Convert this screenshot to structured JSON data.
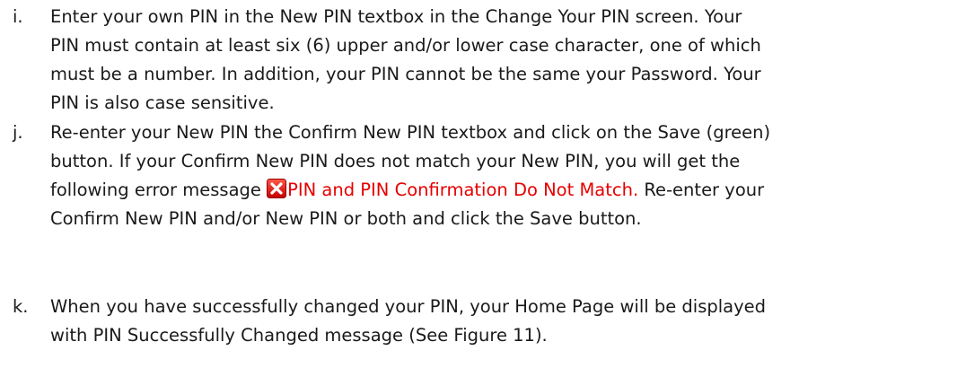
{
  "items": [
    {
      "marker": "i.",
      "lines": [
        "Enter your own PIN in the New PIN textbox in the Change Your PIN screen.   Your",
        "PIN must contain at least six (6) upper and/or lower case character, one of which",
        "must be a number.  In addition, your PIN cannot be the same your Password.  Your",
        "PIN is also case sensitive."
      ]
    },
    {
      "marker": "j.",
      "lines": [
        "Re-enter your New PIN the Confirm New PIN textbox and click on the Save (green)",
        "button.  If your Confirm New PIN does not match your New PIN, you will get the"
      ],
      "line3_before": "following error message ",
      "error_icon": "red-x-error-icon",
      "error_message": "PIN and PIN Confirmation Do Not Match.",
      "line3_after": "  Re-enter your",
      "line4": "Confirm New PIN and/or New PIN or both and click the Save button."
    },
    {
      "marker": "k.",
      "lines": [
        "When you have successfully changed your PIN, your Home Page will be displayed",
        "with PIN Successfully Changed message (See Figure 11)."
      ]
    }
  ],
  "colors": {
    "error_text": "#e60000",
    "body_text": "#1a1a1a"
  }
}
